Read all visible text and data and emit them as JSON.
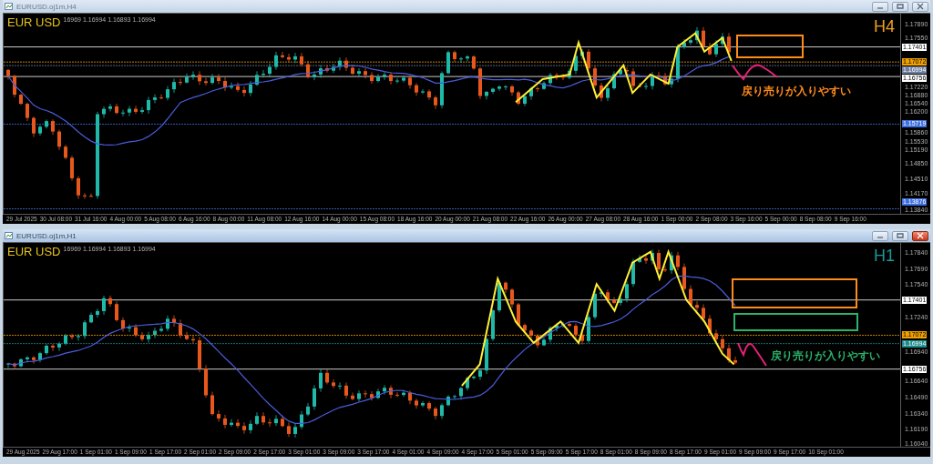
{
  "charts": [
    {
      "window_title": "EURUSD.oj1m,H4",
      "active": false,
      "symbol": "EUR USD",
      "ohlc": "16969 1.16994 1.16893 1.16994",
      "timeframe": {
        "text": "H4",
        "color": "#f0a020"
      },
      "annotation": {
        "text": "戻り売りが入りやすい",
        "color": "#ff8c1a"
      },
      "price_ticks": [
        "1.17890",
        "1.17550",
        "1.17220",
        "1.16880",
        "1.16540",
        "1.16200",
        "1.15860",
        "1.15530",
        "1.15190",
        "1.14850",
        "1.14510",
        "1.14170",
        "1.13840"
      ],
      "price_tags": [
        {
          "text": "1.17401",
          "color": "#ffffff"
        },
        {
          "text": "1.17072",
          "color": "#f0a000"
        },
        {
          "text": "1.16994",
          "color": "#6f7f9f"
        },
        {
          "text": "1.16756",
          "color": "#ffffff"
        },
        {
          "text": "1.15719",
          "color": "#3d6fe0"
        },
        {
          "text": "1.13876",
          "color": "#3d6fe0"
        }
      ],
      "time_ticks": [
        "29 Jul 2025",
        "30 Jul 08:00",
        "31 Jul 16:00",
        "4 Aug 00:00",
        "5 Aug 08:00",
        "6 Aug 16:00",
        "8 Aug 00:00",
        "11 Aug 08:00",
        "12 Aug 16:00",
        "14 Aug 00:00",
        "15 Aug 08:00",
        "18 Aug 16:00",
        "20 Aug 00:00",
        "21 Aug 08:00",
        "22 Aug 16:00",
        "26 Aug 00:00",
        "27 Aug 08:00",
        "28 Aug 16:00",
        "1 Sep 00:00",
        "2 Sep 08:00",
        "3 Sep 16:00",
        "5 Sep 00:00",
        "8 Sep 08:00",
        "9 Sep 16:00"
      ]
    },
    {
      "window_title": "EURUSD.oj1m,H1",
      "active": true,
      "symbol": "EUR USD",
      "ohlc": "16969 1.16994 1.16893 1.16994",
      "timeframe": {
        "text": "H1",
        "color": "#1a9a9a"
      },
      "annotation": {
        "text": "戻り売りが入りやすい",
        "color": "#2ab36a"
      },
      "price_ticks": [
        "1.17840",
        "1.17690",
        "1.17540",
        "1.17240",
        "1.16940",
        "1.16640",
        "1.16490",
        "1.16340",
        "1.16190",
        "1.16040"
      ],
      "price_tags": [
        {
          "text": "1.17401",
          "color": "#ffffff"
        },
        {
          "text": "1.17072",
          "color": "#f0a000"
        },
        {
          "text": "1.16994",
          "color": "#1a8a8a"
        },
        {
          "text": "1.16756",
          "color": "#ffffff"
        }
      ],
      "time_ticks": [
        "29 Aug 2025",
        "29 Aug 17:00",
        "1 Sep 01:00",
        "1 Sep 09:00",
        "1 Sep 17:00",
        "2 Sep 01:00",
        "2 Sep 09:00",
        "2 Sep 17:00",
        "3 Sep 01:00",
        "3 Sep 09:00",
        "3 Sep 17:00",
        "4 Sep 01:00",
        "4 Sep 09:00",
        "4 Sep 17:00",
        "5 Sep 01:00",
        "5 Sep 09:00",
        "5 Sep 17:00",
        "8 Sep 01:00",
        "8 Sep 09:00",
        "8 Sep 17:00",
        "9 Sep 01:00",
        "9 Sep 09:00",
        "9 Sep 17:00",
        "10 Sep 01:00"
      ]
    }
  ]
}
